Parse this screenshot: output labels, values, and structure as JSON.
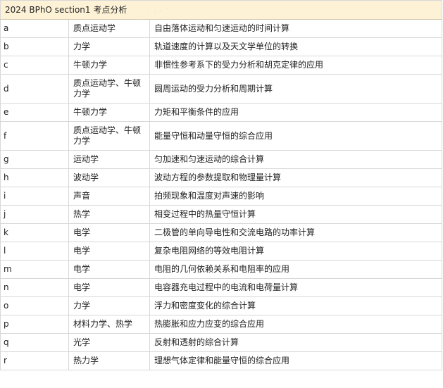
{
  "table": {
    "title": "2024 BPhO section1 考点分析",
    "rows": [
      {
        "id": "a",
        "category": "质点运动学",
        "description": "自由落体运动和匀速运动的时间计算"
      },
      {
        "id": "b",
        "category": "力学",
        "description": "轨道速度的计算以及天文学单位的转换"
      },
      {
        "id": "c",
        "category": "牛顿力学",
        "description": "非惯性参考系下的受力分析和胡克定律的应用"
      },
      {
        "id": "d",
        "category": "质点运动学、牛顿力学",
        "description": "圆周运动的受力分析和周期计算"
      },
      {
        "id": "e",
        "category": "牛顿力学",
        "description": "力矩和平衡条件的应用"
      },
      {
        "id": "f",
        "category": "质点运动学、牛顿力学",
        "description": "能量守恒和动量守恒的综合应用"
      },
      {
        "id": "g",
        "category": "运动学",
        "description": "匀加速和匀速运动的综合计算"
      },
      {
        "id": "h",
        "category": "波动学",
        "description": "波动方程的参数提取和物理量计算"
      },
      {
        "id": "i",
        "category": "声音",
        "description": "拍频现象和温度对声速的影响"
      },
      {
        "id": "j",
        "category": "热学",
        "description": "相变过程中的热量守恒计算"
      },
      {
        "id": "k",
        "category": "电学",
        "description": "二极管的单向导电性和交流电路的功率计算"
      },
      {
        "id": "l",
        "category": "电学",
        "description": "复杂电阻网络的等效电阻计算"
      },
      {
        "id": "m",
        "category": "电学",
        "description": "电阻的几何依赖关系和电阻率的应用"
      },
      {
        "id": "n",
        "category": "电学",
        "description": "电容器充电过程中的电流和电荷量计算"
      },
      {
        "id": "o",
        "category": "力学",
        "description": "浮力和密度变化的综合计算"
      },
      {
        "id": "p",
        "category": "材料力学、热学",
        "description": "热膨胀和应力应变的综合应用"
      },
      {
        "id": "q",
        "category": "光学",
        "description": "反射和透射的综合计算"
      },
      {
        "id": "r",
        "category": "热力学",
        "description": "理想气体定律和能量守恒的综合应用"
      }
    ]
  }
}
